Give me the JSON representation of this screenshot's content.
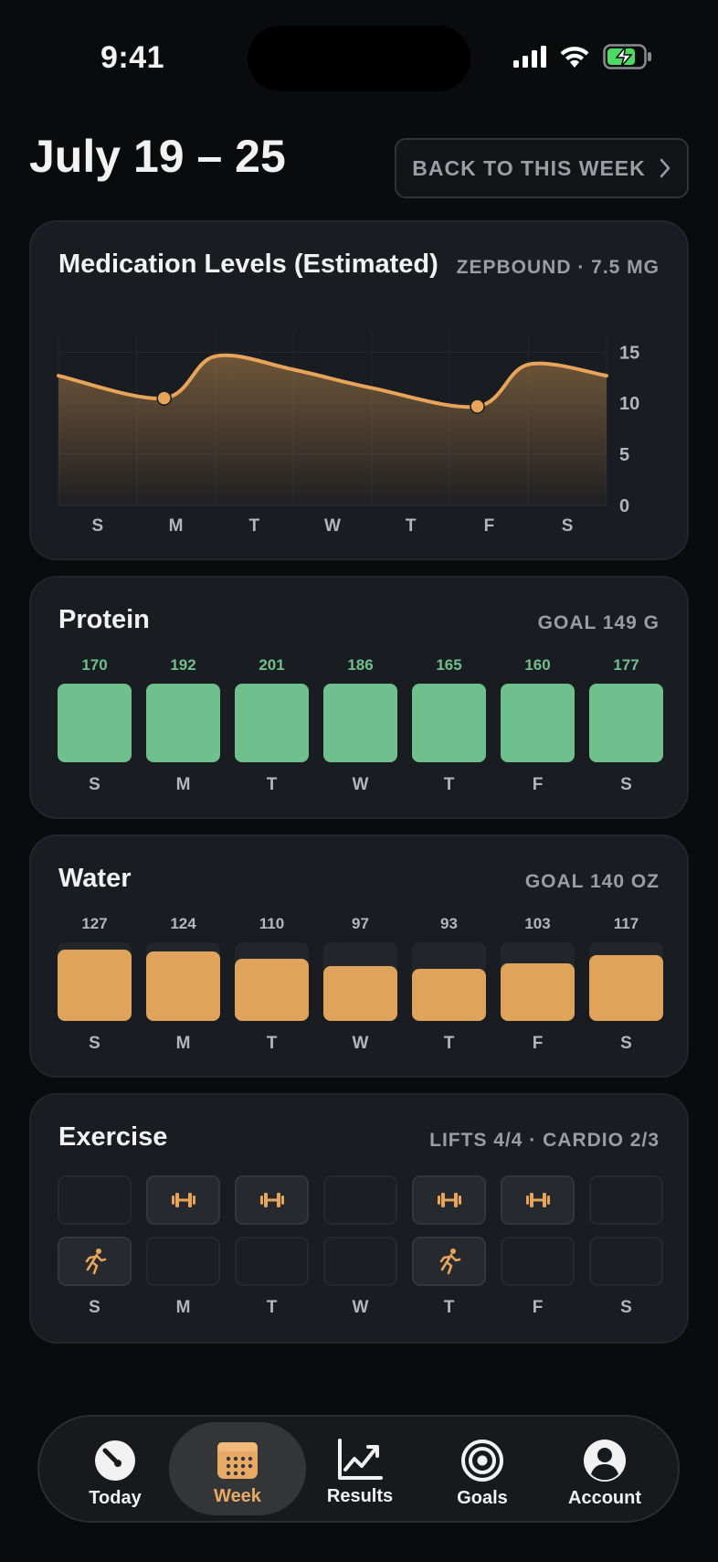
{
  "status": {
    "time": "9:41"
  },
  "header": {
    "week_range": "July 19 – 25",
    "back_button": "BACK TO THIS WEEK"
  },
  "medication": {
    "title": "Medication Levels (Estimated)",
    "meta": "ZEPBOUND · 7.5 MG",
    "accent": "#e8a559"
  },
  "chart_data": {
    "type": "area",
    "title": "Medication Levels (Estimated)",
    "x": [
      "S",
      "M",
      "T",
      "W",
      "T",
      "F",
      "S"
    ],
    "y_ticks": [
      0,
      5,
      10,
      15
    ],
    "ylim": [
      0,
      17
    ],
    "series": [
      {
        "points": [
          [
            0,
            12.7
          ],
          [
            1.35,
            10.5
          ],
          [
            2.0,
            14.6
          ],
          [
            3.0,
            13.3
          ],
          [
            4.0,
            11.5
          ],
          [
            5.35,
            9.7
          ],
          [
            6.0,
            13.8
          ],
          [
            7.0,
            12.7
          ]
        ]
      }
    ],
    "dose_markers": [
      [
        1.35,
        10.5
      ],
      [
        5.35,
        9.7
      ]
    ],
    "grid": true
  },
  "protein": {
    "title": "Protein",
    "meta": "GOAL 149 G",
    "goal": 149,
    "days": [
      {
        "day": "S",
        "value": "170"
      },
      {
        "day": "M",
        "value": "192"
      },
      {
        "day": "T",
        "value": "201"
      },
      {
        "day": "W",
        "value": "186"
      },
      {
        "day": "T",
        "value": "165"
      },
      {
        "day": "F",
        "value": "160"
      },
      {
        "day": "S",
        "value": "177"
      }
    ]
  },
  "water": {
    "title": "Water",
    "meta": "GOAL 140 OZ",
    "goal": 140,
    "days": [
      {
        "day": "S",
        "value": "127"
      },
      {
        "day": "M",
        "value": "124"
      },
      {
        "day": "T",
        "value": "110"
      },
      {
        "day": "W",
        "value": "97"
      },
      {
        "day": "T",
        "value": "93"
      },
      {
        "day": "F",
        "value": "103"
      },
      {
        "day": "S",
        "value": "117"
      }
    ]
  },
  "exercise": {
    "title": "Exercise",
    "meta": "LIFTS 4/4 · CARDIO 2/3",
    "days": [
      "S",
      "M",
      "T",
      "W",
      "T",
      "F",
      "S"
    ],
    "lifts": [
      false,
      true,
      true,
      false,
      true,
      true,
      false
    ],
    "cardio": [
      true,
      false,
      false,
      false,
      true,
      false,
      false
    ],
    "lift_icon": "dumbbell-icon",
    "cardio_icon": "running-icon"
  },
  "tabs": [
    {
      "label": "Today",
      "icon": "gauge-icon",
      "active": false
    },
    {
      "label": "Week",
      "icon": "calendar-icon",
      "active": true
    },
    {
      "label": "Results",
      "icon": "trend-chart-icon",
      "active": false
    },
    {
      "label": "Goals",
      "icon": "target-icon",
      "active": false
    },
    {
      "label": "Account",
      "icon": "person-icon",
      "active": false
    }
  ]
}
